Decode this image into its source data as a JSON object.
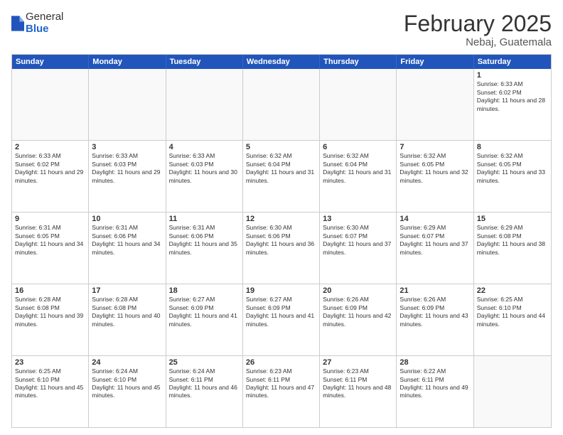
{
  "logo": {
    "general": "General",
    "blue": "Blue"
  },
  "title": "February 2025",
  "location": "Nebaj, Guatemala",
  "days_of_week": [
    "Sunday",
    "Monday",
    "Tuesday",
    "Wednesday",
    "Thursday",
    "Friday",
    "Saturday"
  ],
  "weeks": [
    [
      {
        "day": "",
        "info": ""
      },
      {
        "day": "",
        "info": ""
      },
      {
        "day": "",
        "info": ""
      },
      {
        "day": "",
        "info": ""
      },
      {
        "day": "",
        "info": ""
      },
      {
        "day": "",
        "info": ""
      },
      {
        "day": "1",
        "info": "Sunrise: 6:33 AM\nSunset: 6:02 PM\nDaylight: 11 hours and 28 minutes."
      }
    ],
    [
      {
        "day": "2",
        "info": "Sunrise: 6:33 AM\nSunset: 6:02 PM\nDaylight: 11 hours and 29 minutes."
      },
      {
        "day": "3",
        "info": "Sunrise: 6:33 AM\nSunset: 6:03 PM\nDaylight: 11 hours and 29 minutes."
      },
      {
        "day": "4",
        "info": "Sunrise: 6:33 AM\nSunset: 6:03 PM\nDaylight: 11 hours and 30 minutes."
      },
      {
        "day": "5",
        "info": "Sunrise: 6:32 AM\nSunset: 6:04 PM\nDaylight: 11 hours and 31 minutes."
      },
      {
        "day": "6",
        "info": "Sunrise: 6:32 AM\nSunset: 6:04 PM\nDaylight: 11 hours and 31 minutes."
      },
      {
        "day": "7",
        "info": "Sunrise: 6:32 AM\nSunset: 6:05 PM\nDaylight: 11 hours and 32 minutes."
      },
      {
        "day": "8",
        "info": "Sunrise: 6:32 AM\nSunset: 6:05 PM\nDaylight: 11 hours and 33 minutes."
      }
    ],
    [
      {
        "day": "9",
        "info": "Sunrise: 6:31 AM\nSunset: 6:05 PM\nDaylight: 11 hours and 34 minutes."
      },
      {
        "day": "10",
        "info": "Sunrise: 6:31 AM\nSunset: 6:06 PM\nDaylight: 11 hours and 34 minutes."
      },
      {
        "day": "11",
        "info": "Sunrise: 6:31 AM\nSunset: 6:06 PM\nDaylight: 11 hours and 35 minutes."
      },
      {
        "day": "12",
        "info": "Sunrise: 6:30 AM\nSunset: 6:06 PM\nDaylight: 11 hours and 36 minutes."
      },
      {
        "day": "13",
        "info": "Sunrise: 6:30 AM\nSunset: 6:07 PM\nDaylight: 11 hours and 37 minutes."
      },
      {
        "day": "14",
        "info": "Sunrise: 6:29 AM\nSunset: 6:07 PM\nDaylight: 11 hours and 37 minutes."
      },
      {
        "day": "15",
        "info": "Sunrise: 6:29 AM\nSunset: 6:08 PM\nDaylight: 11 hours and 38 minutes."
      }
    ],
    [
      {
        "day": "16",
        "info": "Sunrise: 6:28 AM\nSunset: 6:08 PM\nDaylight: 11 hours and 39 minutes."
      },
      {
        "day": "17",
        "info": "Sunrise: 6:28 AM\nSunset: 6:08 PM\nDaylight: 11 hours and 40 minutes."
      },
      {
        "day": "18",
        "info": "Sunrise: 6:27 AM\nSunset: 6:09 PM\nDaylight: 11 hours and 41 minutes."
      },
      {
        "day": "19",
        "info": "Sunrise: 6:27 AM\nSunset: 6:09 PM\nDaylight: 11 hours and 41 minutes."
      },
      {
        "day": "20",
        "info": "Sunrise: 6:26 AM\nSunset: 6:09 PM\nDaylight: 11 hours and 42 minutes."
      },
      {
        "day": "21",
        "info": "Sunrise: 6:26 AM\nSunset: 6:09 PM\nDaylight: 11 hours and 43 minutes."
      },
      {
        "day": "22",
        "info": "Sunrise: 6:25 AM\nSunset: 6:10 PM\nDaylight: 11 hours and 44 minutes."
      }
    ],
    [
      {
        "day": "23",
        "info": "Sunrise: 6:25 AM\nSunset: 6:10 PM\nDaylight: 11 hours and 45 minutes."
      },
      {
        "day": "24",
        "info": "Sunrise: 6:24 AM\nSunset: 6:10 PM\nDaylight: 11 hours and 45 minutes."
      },
      {
        "day": "25",
        "info": "Sunrise: 6:24 AM\nSunset: 6:11 PM\nDaylight: 11 hours and 46 minutes."
      },
      {
        "day": "26",
        "info": "Sunrise: 6:23 AM\nSunset: 6:11 PM\nDaylight: 11 hours and 47 minutes."
      },
      {
        "day": "27",
        "info": "Sunrise: 6:23 AM\nSunset: 6:11 PM\nDaylight: 11 hours and 48 minutes."
      },
      {
        "day": "28",
        "info": "Sunrise: 6:22 AM\nSunset: 6:11 PM\nDaylight: 11 hours and 49 minutes."
      },
      {
        "day": "",
        "info": ""
      }
    ]
  ]
}
